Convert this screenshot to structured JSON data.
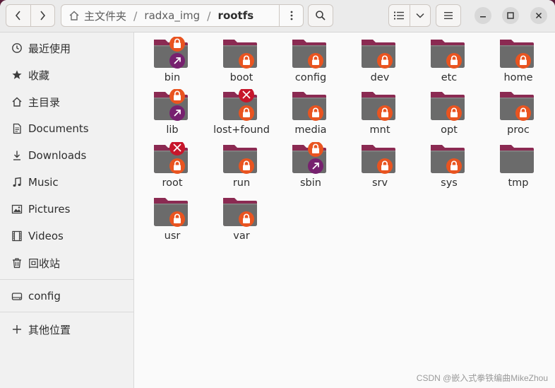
{
  "toolbar": {
    "back_icon": "chevron-left-icon",
    "forward_icon": "chevron-right-icon",
    "home_icon": "home-icon",
    "path": [
      "主文件夹",
      "radxa_img",
      "rootfs"
    ],
    "path_separator": "/",
    "path_menu_icon": "vertical-dots-icon",
    "search_icon": "search-icon",
    "view_icon": "list-view-icon",
    "view_dropdown_icon": "chevron-down-icon",
    "menu_icon": "hamburger-icon",
    "minimize_icon": "minimize-icon",
    "maximize_icon": "maximize-icon",
    "close_icon": "close-icon"
  },
  "sidebar": {
    "items": [
      {
        "label": "最近使用",
        "icon": "clock-icon"
      },
      {
        "label": "收藏",
        "icon": "star-icon"
      },
      {
        "label": "主目录",
        "icon": "home-icon"
      },
      {
        "label": "Documents",
        "icon": "document-icon"
      },
      {
        "label": "Downloads",
        "icon": "download-icon"
      },
      {
        "label": "Music",
        "icon": "music-icon"
      },
      {
        "label": "Pictures",
        "icon": "picture-icon"
      },
      {
        "label": "Videos",
        "icon": "video-icon"
      },
      {
        "label": "回收站",
        "icon": "trash-icon"
      },
      {
        "label": "config",
        "icon": "drive-icon"
      },
      {
        "label": "其他位置",
        "icon": "plus-icon"
      }
    ]
  },
  "files": [
    {
      "name": "bin",
      "badges": [
        "lock",
        "link"
      ]
    },
    {
      "name": "boot",
      "badges": [
        "lock"
      ]
    },
    {
      "name": "config",
      "badges": [
        "lock"
      ]
    },
    {
      "name": "dev",
      "badges": [
        "lock"
      ]
    },
    {
      "name": "etc",
      "badges": [
        "lock"
      ]
    },
    {
      "name": "home",
      "badges": [
        "lock"
      ]
    },
    {
      "name": "lib",
      "badges": [
        "lock",
        "link"
      ]
    },
    {
      "name": "lost+found",
      "badges": [
        "denied",
        "lock"
      ]
    },
    {
      "name": "media",
      "badges": [
        "lock"
      ]
    },
    {
      "name": "mnt",
      "badges": [
        "lock"
      ]
    },
    {
      "name": "opt",
      "badges": [
        "lock"
      ]
    },
    {
      "name": "proc",
      "badges": [
        "lock"
      ]
    },
    {
      "name": "root",
      "badges": [
        "denied",
        "lock"
      ]
    },
    {
      "name": "run",
      "badges": [
        "lock"
      ]
    },
    {
      "name": "sbin",
      "badges": [
        "lock",
        "link"
      ]
    },
    {
      "name": "srv",
      "badges": [
        "lock"
      ]
    },
    {
      "name": "sys",
      "badges": [
        "lock"
      ]
    },
    {
      "name": "tmp",
      "badges": []
    },
    {
      "name": "usr",
      "badges": [
        "lock"
      ]
    },
    {
      "name": "var",
      "badges": [
        "lock"
      ]
    }
  ],
  "colors": {
    "folder_body": "#6b6b6b",
    "folder_tab": "#8b2a52",
    "lock_badge": "#e95420",
    "link_badge": "#77216f",
    "denied_badge": "#c7162b"
  },
  "watermark": "CSDN @嵌入式拳铁编曲MikeZhou"
}
